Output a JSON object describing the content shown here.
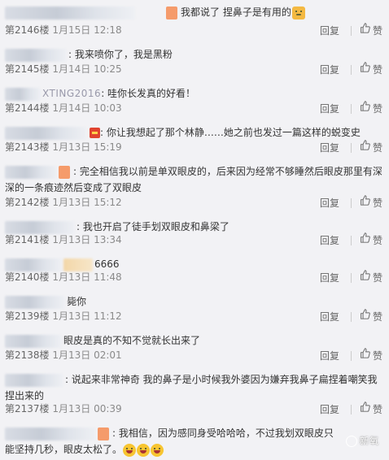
{
  "actions": {
    "reply": "回复",
    "like": "赞"
  },
  "comments": [
    {
      "user": "",
      "text": "我都说了 捏鼻子是有用的",
      "floor": "第2146楼",
      "date": "1月15日",
      "time": "12:18"
    },
    {
      "user": "",
      "text": ": 我来喷你了，我是黑粉",
      "floor": "第2145楼",
      "date": "1月14日",
      "time": "10:25"
    },
    {
      "user": "XTING2016",
      "text": ": 哇你长发真的好看！",
      "floor": "第2144楼",
      "date": "1月14日",
      "time": "10:03"
    },
    {
      "user": "",
      "text": ": 你让我想起了那个林静……她之前也发过一篇这样的蜕变史",
      "floor": "第2143楼",
      "date": "1月13日",
      "time": "15:19"
    },
    {
      "user": "",
      "text": ": 完全相信我以前是单双眼皮的，后来因为经常不够睡然后眼皮那里有深深的一条痕迹然后变成了双眼皮",
      "floor": "第2142楼",
      "date": "1月13日",
      "time": "15:12"
    },
    {
      "user": "",
      "text": ": 我也开启了徒手划双眼皮和鼻梁了",
      "floor": "第2141楼",
      "date": "1月13日",
      "time": "13:34"
    },
    {
      "user": "",
      "text": "6666",
      "floor": "第2140楼",
      "date": "1月13日",
      "time": "11:48"
    },
    {
      "user": "",
      "text": "毙你",
      "floor": "第2139楼",
      "date": "1月13日",
      "time": "11:12"
    },
    {
      "user": "",
      "text": "眼皮是真的不知不觉就长出来了",
      "floor": "第2138楼",
      "date": "1月13日",
      "time": "02:01"
    },
    {
      "user": "",
      "text": ": 说起来非常神奇  我的鼻子是小时候我外婆因为嫌弃我鼻子扁捏着嘲笑我捏出来的",
      "floor": "第2137楼",
      "date": "1月13日",
      "time": "00:39"
    },
    {
      "user": "",
      "text": ": 我相信，因为感同身受哈哈哈，不过我划双眼皮只能坚持几秒，眼皮太松了。",
      "floor": "",
      "date": "",
      "time": ""
    }
  ],
  "watermark": "新氧"
}
